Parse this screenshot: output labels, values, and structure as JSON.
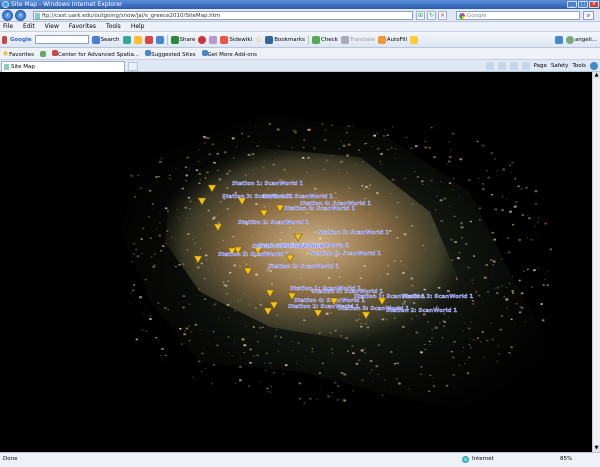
{
  "window": {
    "title": "Site Map - Windows Internet Explorer"
  },
  "address": {
    "url": "ftp://cast.uark.edu/outgoing/snow/jai/s_greece2010/SiteMap.htm",
    "search_placeholder": "Google"
  },
  "menu": [
    "File",
    "Edit",
    "View",
    "Favorites",
    "Tools",
    "Help"
  ],
  "toolbar": {
    "google_label": "Google",
    "search_label": "Search",
    "share_label": "Share",
    "sidewiki_label": "Sidewiki",
    "bookmarks_label": "Bookmarks",
    "check_label": "Check",
    "translate_label": "Translate",
    "autofill_label": "AutoFill",
    "user_label": "angeli..."
  },
  "favorites": {
    "label": "Favorites",
    "items": [
      "Center for Advanced Spatia...",
      "Suggested Sites",
      "Get More Add-ons"
    ]
  },
  "tab": {
    "label": "Site Map"
  },
  "commands": [
    "Page",
    "Safety",
    "Tools"
  ],
  "stations": [
    "Station 1: ScanWorld 1",
    "Station 3: ScanWorld 1",
    "Station 3: ScanWorld 1",
    "Station 4: ScanWorld 1",
    "Station 4: ScanWorld 1",
    "Station 2: ScanWorld 1",
    "Station 5: ScanWorld 1",
    "Station 5: ScanWorld 1",
    "Station 1: ScanWorld 1",
    "Station 3: ScanWorld 1",
    "Station 2: ScanWorld 1",
    "Station 6: ScanWorld 1",
    "Station 2: ScanWorld 1",
    "Station 1: ScanWorld 1",
    "Station 5: ScanWorld 1",
    "Station 4: ScanWorld 1",
    "Station 2: ScanWorld 1",
    "Station 1: ScanWorld 1",
    "Station 3: ScanWorld 1",
    "Station 5: ScanWorld 1",
    "Station 2: ScanWorld 1"
  ],
  "status": {
    "text": "Done",
    "zone": "Internet",
    "zoom": "85%"
  }
}
